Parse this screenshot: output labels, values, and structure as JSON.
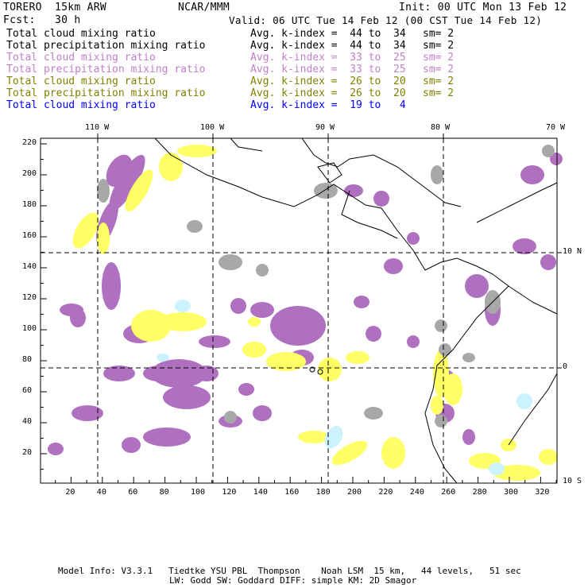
{
  "header": {
    "model": "TORERO  15km ARW",
    "org": "NCAR/MMM",
    "init": "Init: 00 UTC Mon 13 Feb 12",
    "fcst": "Fcst:   30 h",
    "valid": "Valid: 06 UTC Tue 14 Feb 12 (00 CST Tue 14 Feb 12)"
  },
  "legend": [
    {
      "field": "Total cloud mixing ratio",
      "range": "Avg. k-index =  44 to  34",
      "sm": "sm= 2",
      "color": "#000000"
    },
    {
      "field": "Total precipitation mixing ratio",
      "range": "Avg. k-index =  44 to  34",
      "sm": "sm= 2",
      "color": "#000000"
    },
    {
      "field": "Total cloud mixing ratio",
      "range": "Avg. k-index =  33 to  25",
      "sm": "sm= 2",
      "color": "#c080c8"
    },
    {
      "field": "Total precipitation mixing ratio",
      "range": "Avg. k-index =  33 to  25",
      "sm": "sm= 2",
      "color": "#c080c8"
    },
    {
      "field": "Total cloud mixing ratio",
      "range": "Avg. k-index =  26 to  20",
      "sm": "sm= 2",
      "color": "#808000"
    },
    {
      "field": "Total precipitation mixing ratio",
      "range": "Avg. k-index =  26 to  20",
      "sm": "sm= 2",
      "color": "#808000"
    },
    {
      "field": "Total cloud mixing ratio",
      "range": "Avg. k-index =  19 to   4",
      "sm": "",
      "color": "#0000ff"
    }
  ],
  "axes": {
    "x_ticks": [
      "20",
      "40",
      "60",
      "80",
      "100",
      "120",
      "140",
      "160",
      "180",
      "200",
      "220",
      "240",
      "260",
      "280",
      "300",
      "320"
    ],
    "y_ticks": [
      "20",
      "40",
      "60",
      "80",
      "100",
      "120",
      "140",
      "160",
      "180",
      "200",
      "220"
    ],
    "lon_labels": [
      "110 W",
      "100 W",
      "90 W",
      "80 W",
      "70 W"
    ],
    "lat_labels": [
      "10 N",
      "0",
      "10 S"
    ]
  },
  "footer": {
    "line1": "Model Info: V3.3.1   Tiedtke YSU PBL  Thompson    Noah LSM  15 km,   44 levels,   51 sec",
    "line2": "LW: Godd SW: Goddard DIFF: simple KM: 2D Smagor"
  },
  "colors": {
    "purple": "#b070c0",
    "yellow": "#ffff66",
    "gray": "#a8a8a8",
    "cyan": "#ccf2ff"
  }
}
